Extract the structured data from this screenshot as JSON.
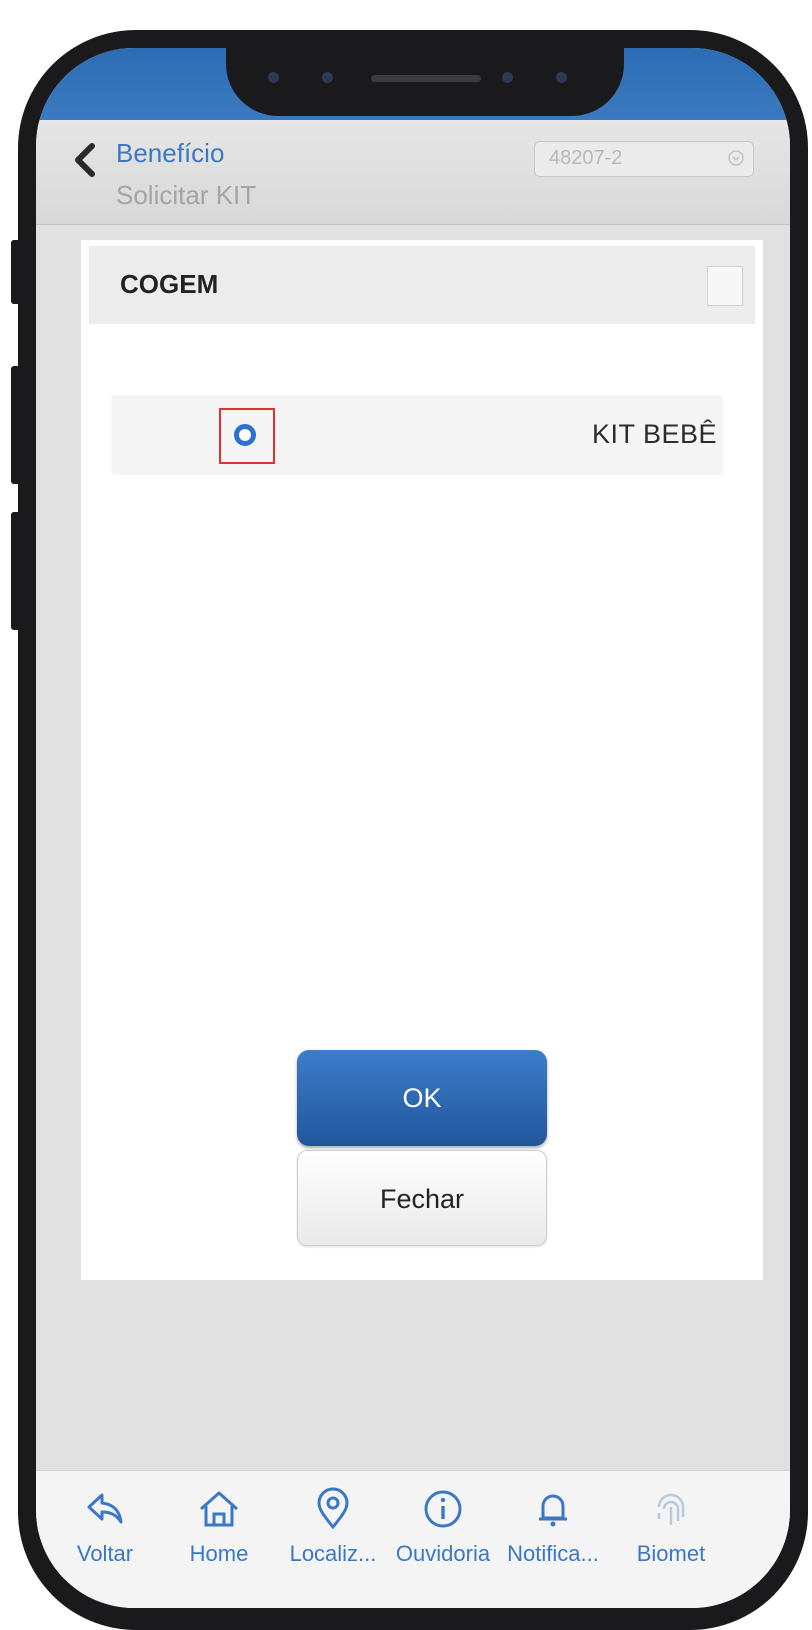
{
  "navbar": {
    "title": "Benefício",
    "subtitle": "Solicitar KIT",
    "account_value": "48207-2"
  },
  "dialog": {
    "title": "COGEM",
    "option_label": "KIT BEBÊ",
    "ok_label": "OK",
    "close_label": "Fechar"
  },
  "tabbar": {
    "tabs": [
      {
        "label": "Voltar",
        "icon": "share-back-icon"
      },
      {
        "label": "Home",
        "icon": "home-icon"
      },
      {
        "label": "Localiz...",
        "icon": "location-pin-icon"
      },
      {
        "label": "Ouvidoria",
        "icon": "info-icon"
      },
      {
        "label": "Notifica...",
        "icon": "bell-icon"
      },
      {
        "label": "Biomet",
        "icon": "fingerprint-icon"
      }
    ]
  },
  "colors": {
    "accent_blue": "#3f78c2",
    "status_band": "#2b6cb4",
    "highlight_red": "#e03030"
  }
}
